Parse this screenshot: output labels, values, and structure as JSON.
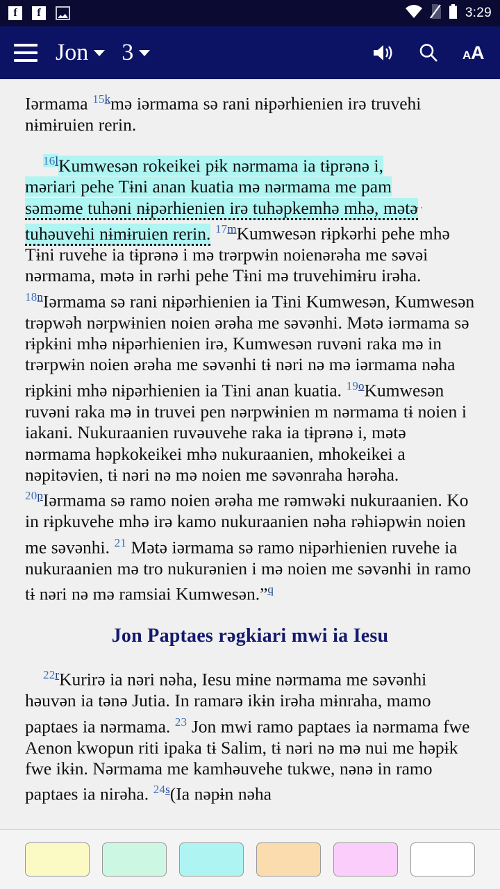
{
  "status_bar": {
    "time": "3:29",
    "left_icons": [
      {
        "name": "facebook-notification-icon",
        "glyph": "f"
      },
      {
        "name": "facebook-notification-icon-2",
        "glyph": "f"
      },
      {
        "name": "screenshot-image-icon",
        "glyph": ""
      }
    ],
    "right_icons": [
      {
        "name": "wifi-icon"
      },
      {
        "name": "sim-card-missing-icon"
      },
      {
        "name": "battery-icon"
      }
    ]
  },
  "toolbar": {
    "menu_label": "menu",
    "book": "Jon",
    "chapter": "3",
    "audio_label": "audio",
    "search_label": "search",
    "text_size_label": "AA"
  },
  "content": {
    "para_top": {
      "pre": "Iərmama ",
      "verse_15": "15",
      "fn_k": "k",
      "text": "mə iərmama sə rani nɨpərhienien irə truvehi nɨmɨruien rerin."
    },
    "para_16": {
      "verse_16": "16",
      "fn_l": "l",
      "hl_line1": "Kumwesən rokeikei pɨk nərmama ia tɨprənə i,",
      "hl_line2": "məriari pehe Tɨni anan kuatia mə nərmama me pam",
      "hl_line3": "səməme tuhəni nɨpərhienien irə tuhəpkemhə mhə, mətə",
      "hl_line4": "tuhəuvehi nɨmɨruien rerin.",
      "verse_17": "17",
      "fn_m": "m",
      "text_17": "Kumwesən rɨpkərhi pehe mhə Tɨni ruvehe ia tɨprənə i mə trərpwɨn noienərəha me səvəi nərmama, mətə in rərhi pehe Tɨni mə truvehimɨru irəha.",
      "verse_18": "18",
      "fn_n": "n",
      "text_18": "Iərmama sə rani nɨpərhienien ia Tɨni Kumwesən, Kumwesən trəpwəh nərpwɨnien noien ərəha me səvənhi. Mətə iərmama sə rɨpkɨni mhə nɨpərhienien irə, Kumwesən ruvəni raka mə in trərpwɨn noien ərəha me səvənhi tɨ nəri nə mə iərmama nəha rɨpkɨni mhə nɨpərhienien ia Tɨni anan kuatia.",
      "verse_19": "19",
      "fn_o": "o",
      "text_19": "Kumwesən ruvəni raka mə in truvei pen nərpwɨnien m nərmama tɨ noien i iakani. Nukuraanien ruvəuvehe raka ia tɨprənə i, mətə nərmama həpkokeikei mhə nukuraanien, mhokeikei a nəpitəvien, tɨ nəri nə mə noien me səvənraha hərəha."
    },
    "para_20": {
      "verse_20": "20",
      "fn_p": "p",
      "text_20": "Iərmama sə ramo noien ərəha me rəmwəki nukuraanien. Ko in rɨpkuvehe mhə irə kamo nukuraanien nəha rəhiəpwɨn noien me səvənhi.",
      "verse_21": "21",
      "text_21": "Mətə iərmama sə ramo nɨpərhienien ruvehe ia nukuraanien mə tro nukurənien i mə noien me səvənhi in ramo tɨ nəri nə mə ramsiai Kumwesən.”",
      "fn_q": "q"
    },
    "section_heading": "Jon Paptaes rəgkiari mwi ia Iesu",
    "para_22": {
      "verse_22": "22",
      "fn_r": "r",
      "text_22": "Kurirə ia nəri nəha, Iesu mɨne nərmama me səvənhi həuvən ia tənə Jutia. In ramarə ikɨn irəha mɨnraha, mamo paptaes ia nərmama.",
      "verse_23": "23",
      "text_23": "Jon mwi ramo paptaes ia nərmama fwe Aenon kwopun riti ipaka tɨ Salim, tɨ nəri nə mə nui me həpɨk fwe ikɨn. Nərmama me kamhəuvehe tukwe, nənə in ramo paptaes ia nirəha.",
      "verse_24": "24",
      "fn_s": "s",
      "text_24": "(Ia nəpɨn nəha"
    }
  },
  "palette": {
    "label": "highlight-colors",
    "swatches": [
      {
        "name": "highlight-yellow",
        "color": "#fcfac4"
      },
      {
        "name": "highlight-green",
        "color": "#ccf8e3"
      },
      {
        "name": "highlight-cyan",
        "color": "#aef4f2"
      },
      {
        "name": "highlight-orange",
        "color": "#fadcae"
      },
      {
        "name": "highlight-pink",
        "color": "#fbcdfb"
      },
      {
        "name": "highlight-none",
        "color": "#ffffff"
      }
    ]
  },
  "colors": {
    "toolbar": "#0d1364",
    "statusbar": "#0a0a32",
    "page_bg": "#f0f0f0",
    "verse_number": "#3f6fb8",
    "heading": "#141a6e",
    "highlight_active": "#aff5f2"
  }
}
